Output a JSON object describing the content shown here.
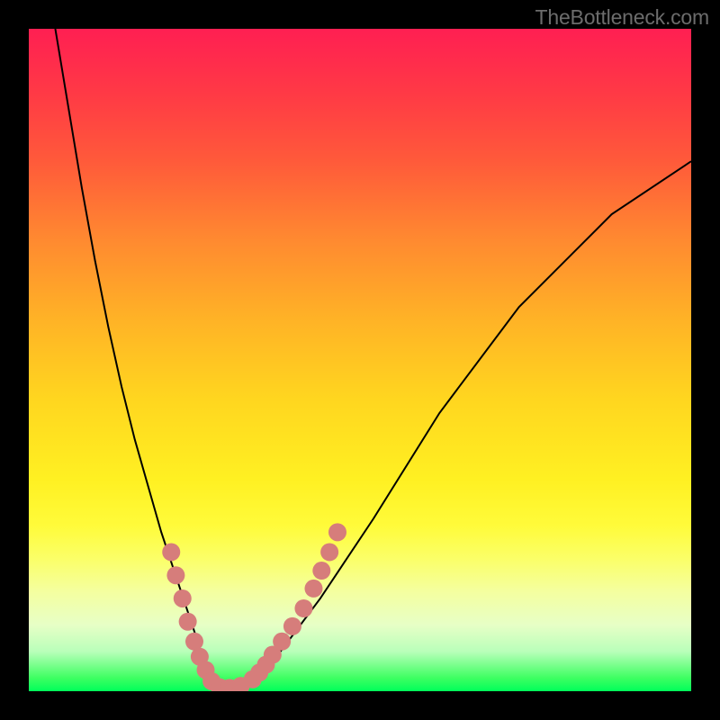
{
  "watermark": "TheBottleneck.com",
  "chart_data": {
    "type": "line",
    "title": "",
    "xlabel": "",
    "ylabel": "",
    "xlim": [
      0,
      100
    ],
    "ylim": [
      0,
      100
    ],
    "series": [
      {
        "name": "curve",
        "x": [
          4,
          6,
          8,
          10,
          12,
          14,
          16,
          18,
          20,
          22,
          24,
          25,
          26,
          27,
          28,
          29,
          30,
          32,
          34,
          38,
          44,
          52,
          62,
          74,
          88,
          100
        ],
        "y": [
          100,
          88,
          76,
          65,
          55,
          46,
          38,
          31,
          24,
          18,
          12,
          9,
          6,
          4,
          2,
          1,
          0.5,
          0.8,
          2,
          6,
          14,
          26,
          42,
          58,
          72,
          80
        ],
        "color": "#000000",
        "stroke_width": 2
      }
    ],
    "markers": [
      {
        "name": "dots-left",
        "color": "#d67d7b",
        "radius": 10,
        "points": [
          {
            "x": 21.5,
            "y": 21
          },
          {
            "x": 22.2,
            "y": 17.5
          },
          {
            "x": 23.2,
            "y": 14
          },
          {
            "x": 24.0,
            "y": 10.5
          },
          {
            "x": 25.0,
            "y": 7.5
          },
          {
            "x": 25.8,
            "y": 5.2
          },
          {
            "x": 26.7,
            "y": 3.2
          },
          {
            "x": 27.6,
            "y": 1.5
          }
        ]
      },
      {
        "name": "dots-bottom",
        "color": "#d67d7b",
        "radius": 10,
        "points": [
          {
            "x": 28.8,
            "y": 0.6
          },
          {
            "x": 30.3,
            "y": 0.5
          },
          {
            "x": 32.0,
            "y": 0.8
          },
          {
            "x": 33.8,
            "y": 1.8
          }
        ]
      },
      {
        "name": "dots-right",
        "color": "#d67d7b",
        "radius": 10,
        "points": [
          {
            "x": 34.8,
            "y": 2.8
          },
          {
            "x": 35.8,
            "y": 4.0
          },
          {
            "x": 36.8,
            "y": 5.5
          },
          {
            "x": 38.2,
            "y": 7.5
          },
          {
            "x": 39.8,
            "y": 9.8
          },
          {
            "x": 41.5,
            "y": 12.5
          },
          {
            "x": 43.0,
            "y": 15.5
          },
          {
            "x": 44.2,
            "y": 18.2
          },
          {
            "x": 45.4,
            "y": 21.0
          },
          {
            "x": 46.6,
            "y": 24.0
          }
        ]
      }
    ]
  }
}
